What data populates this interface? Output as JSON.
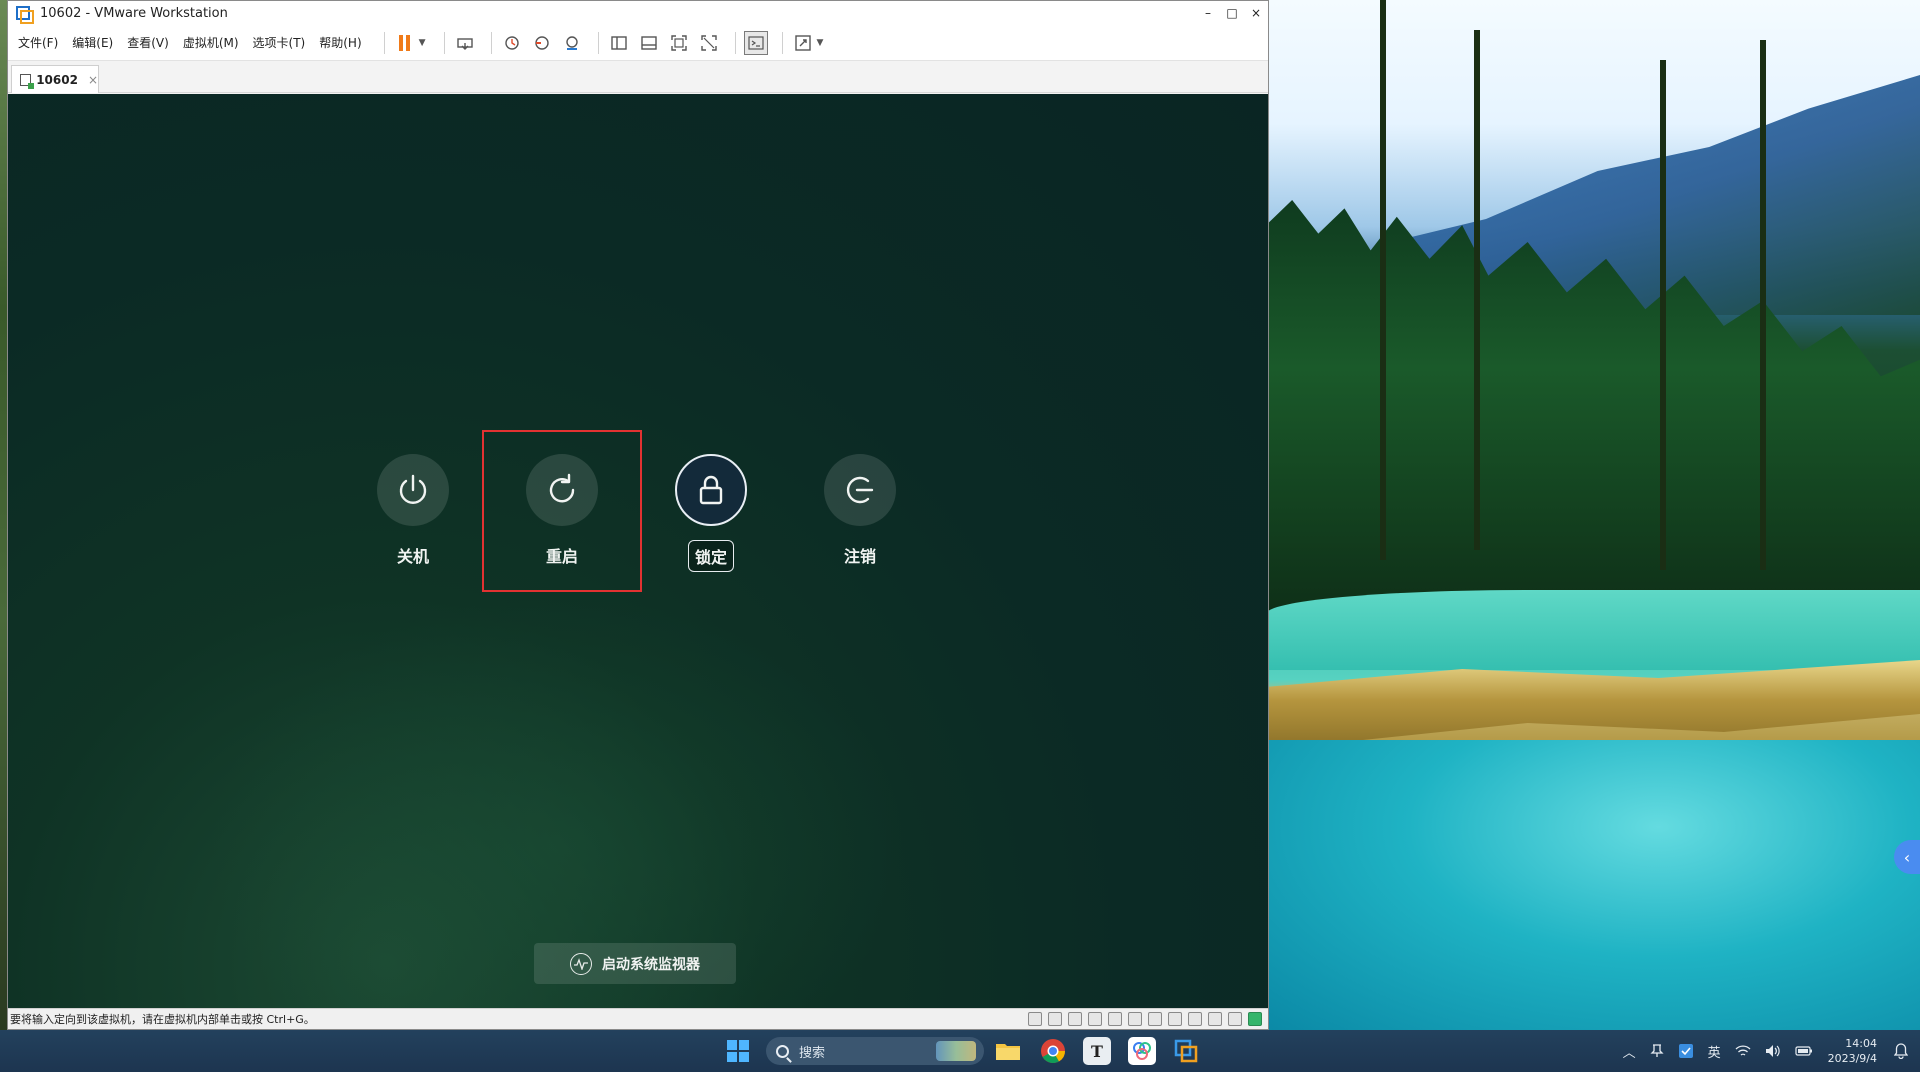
{
  "window": {
    "title": "10602 - VMware Workstation",
    "minimize": "–",
    "maximize": "□",
    "close": "×"
  },
  "menubar": {
    "items": [
      "文件(F)",
      "编辑(E)",
      "查看(V)",
      "虚拟机(M)",
      "选项卡(T)",
      "帮助(H)"
    ]
  },
  "tab": {
    "label": "10602",
    "close": "×"
  },
  "power_menu": {
    "options": [
      {
        "label": "关机",
        "icon": "power-icon"
      },
      {
        "label": "重启",
        "icon": "restart-icon"
      },
      {
        "label": "锁定",
        "icon": "lock-icon",
        "focused": true
      },
      {
        "label": "注销",
        "icon": "logout-icon"
      }
    ],
    "highlighted": "重启",
    "highlight_color": "#e23232",
    "monitor_button": "启动系统监视器"
  },
  "statusbar": {
    "message": "要将输入定向到该虚拟机，请在虚拟机内部单击或按 Ctrl+G。"
  },
  "taskbar": {
    "search_placeholder": "搜索",
    "apps": [
      "file-explorer-icon",
      "chrome-icon",
      "typora-icon",
      "app-icon",
      "vmware-icon"
    ],
    "ime": "英",
    "time": "14:04",
    "date": "2023/9/4"
  },
  "colors": {
    "accent_orange": "#f07a18",
    "taskbar": "#1d3550",
    "vm_background": "#0b2a25"
  }
}
